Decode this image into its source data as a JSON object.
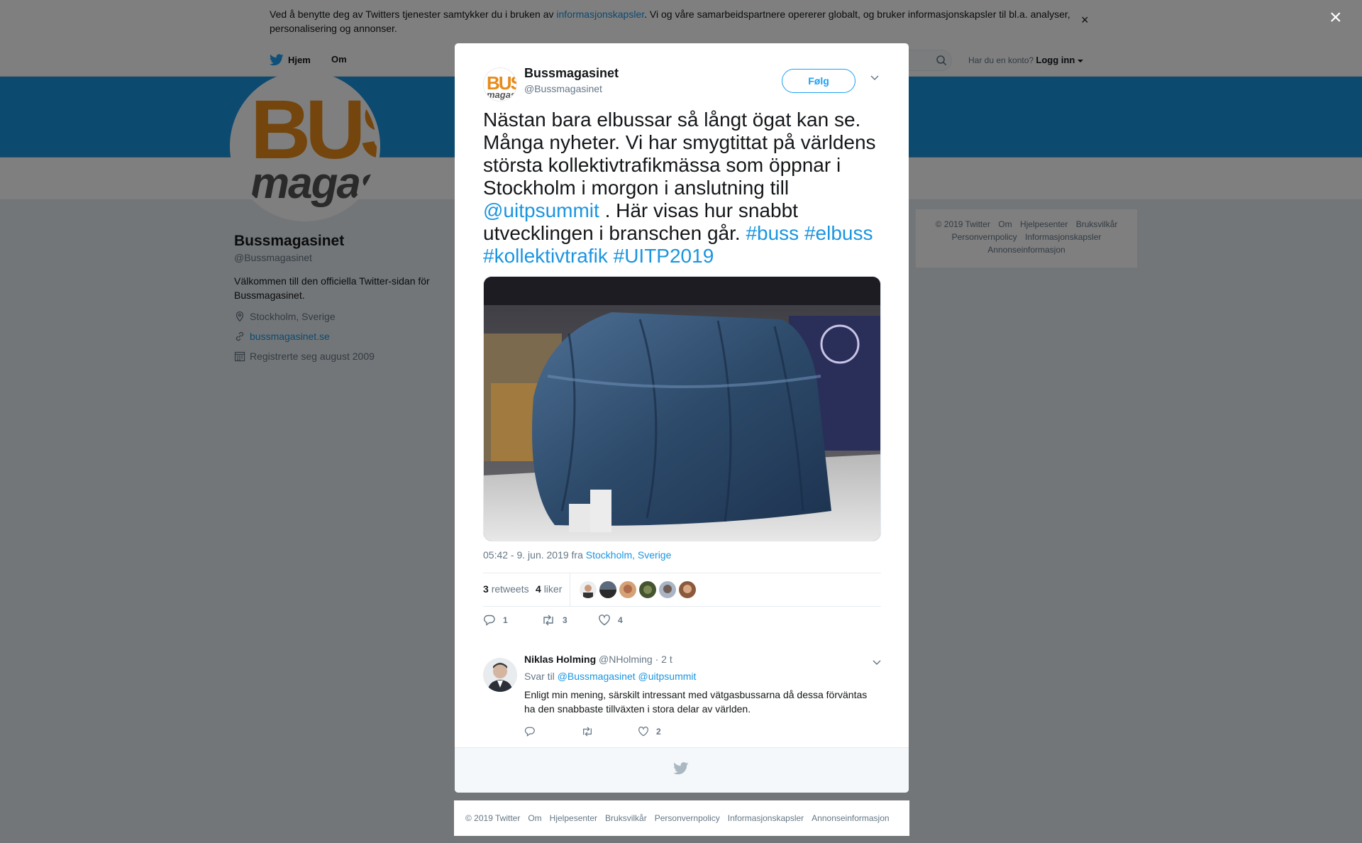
{
  "cookie_banner": {
    "text_before": "Ved å benytte deg av Twitters tjenester samtykker du i bruken av ",
    "link": "informasjonskapsler",
    "text_after": ". Vi og våre samarbeidspartnere opererer globalt, og bruker informasjonskapsler til bl.a. analyser, personalisering og annonser.",
    "close": "×"
  },
  "nav": {
    "home": "Hjem",
    "about": "Om",
    "account_prompt": "Har du en konto?",
    "login": "Logg inn"
  },
  "profile": {
    "name": "Bussmagasinet",
    "handle": "@Bussmagasinet",
    "bio": "Välkommen till den officiella Twitter-sidan för Bussmagasinet.",
    "location": "Stockholm, Sverige",
    "website": "bussmagasinet.se",
    "joined": "Registrerte seg august 2009",
    "logo_top": "BUS",
    "logo_bottom": "magas"
  },
  "side_footer": {
    "row1": [
      "© 2019 Twitter",
      "Om",
      "Hjelpesenter",
      "Bruksvilkår"
    ],
    "row2": [
      "Personvernpolicy",
      "Informasjonskapsler"
    ],
    "row3": [
      "Annonseinformasjon"
    ]
  },
  "page_close": "×",
  "tweet": {
    "author_name": "Bussmagasinet",
    "author_handle": "@Bussmagasinet",
    "avatar_top": "BUS",
    "avatar_bottom": "magasi",
    "follow_label": "Følg",
    "text_1": "Nästan bara elbussar så långt ögat kan se. Många nyheter. Vi har smygtittat på världens största kollektivtrafikmässa som öppnar i Stockholm i morgon i anslutning till ",
    "mention": "@uitpsummit",
    "text_2": " . Här visas hur snabbt utvecklingen i branschen går. ",
    "hashtags": [
      "#buss",
      "#elbuss",
      "#kollektivtrafik",
      "#UITP2019"
    ],
    "timestamp": "05:42 - 9. jun. 2019 fra ",
    "location": "Stockholm, Sverige",
    "retweet_count": "3",
    "retweet_label": "retweets",
    "like_count": "4",
    "like_label": "liker",
    "reply_action_count": "1",
    "retweet_action_count": "3",
    "like_action_count": "4"
  },
  "reply": {
    "name": "Niklas Holming",
    "handle": "@NHolming",
    "time": "· 2 t",
    "to_label": "Svar til",
    "to_1": "@Bussmagasinet",
    "to_2": "@uitpsummit",
    "text": "Enligt min mening, särskilt intressant med vätgasbussarna då dessa förväntas ha den snabbaste tillväxten i stora delar av världen.",
    "like_count": "2"
  },
  "footer": [
    "© 2019 Twitter",
    "Om",
    "Hjelpesenter",
    "Bruksvilkår",
    "Personvernpolicy",
    "Informasjonskapsler",
    "Annonseinformasjon"
  ],
  "colors": {
    "twitter_blue": "#1da1f2",
    "link_blue": "#1b95e0",
    "banner_blue": "#1b95e0",
    "brand_orange": "#e88b1a",
    "text_gray": "#657786"
  },
  "icons": [
    "bird-icon",
    "search-icon",
    "caret-down-icon",
    "location-pin-icon",
    "link-icon",
    "calendar-icon",
    "close-icon",
    "reply-icon",
    "retweet-icon",
    "heart-icon",
    "chevron-down-icon"
  ]
}
